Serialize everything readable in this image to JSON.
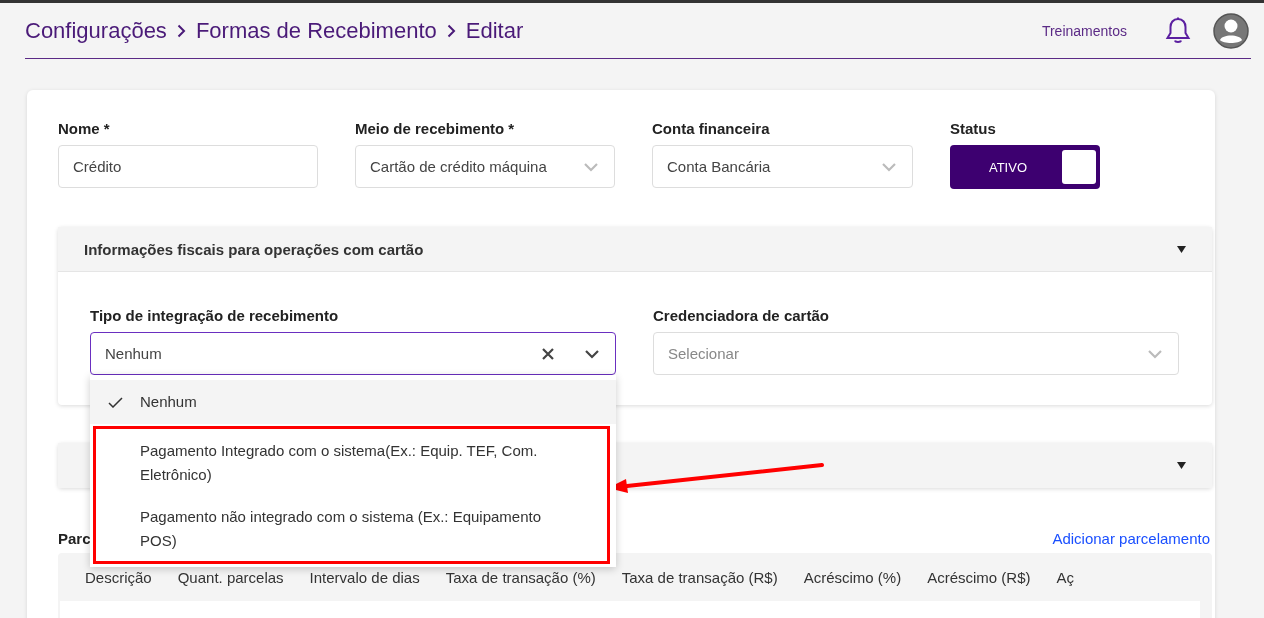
{
  "header": {
    "breadcrumb": [
      "Configurações",
      "Formas de Recebimento",
      "Editar"
    ],
    "link": "Treinamentos"
  },
  "fields": [
    {
      "label": "Nome *",
      "kind": "text",
      "value": "Crédito"
    },
    {
      "label": "Meio de recebimento *",
      "kind": "select",
      "value": "Cartão de crédito máquina"
    },
    {
      "label": "Conta financeira",
      "kind": "select",
      "value": "Conta Bancária"
    },
    {
      "label": "Status",
      "kind": "toggle",
      "on": true,
      "value": "ATIVO"
    }
  ],
  "fiscal_section": {
    "title": "Informações fiscais para operações com cartão",
    "fields": [
      {
        "label": "Tipo de integração de recebimento",
        "kind": "combo",
        "value": "Nenhum",
        "open": true,
        "options": [
          {
            "label": "Nenhum",
            "selected": true,
            "highlighted": false
          },
          {
            "label": "Pagamento Integrado com o sistema(Ex.: Equip. TEF, Com. Eletrônico)",
            "selected": false,
            "highlighted": true
          },
          {
            "label": "Pagamento não integrado com o sistema (Ex.: Equipamento POS)",
            "selected": false,
            "highlighted": true
          }
        ]
      },
      {
        "label": "Credenciadora de cartão",
        "kind": "select",
        "placeholder": "Selecionar"
      }
    ]
  },
  "installments": {
    "title": "Parc",
    "action": "Adicionar parcelamento",
    "columns": [
      "Descrição",
      "Quant. parcelas",
      "Intervalo de dias",
      "Taxa de transação (%)",
      "Taxa de transação (R$)",
      "Acréscimo (%)",
      "Acréscimo (R$)",
      "Aç"
    ]
  }
}
